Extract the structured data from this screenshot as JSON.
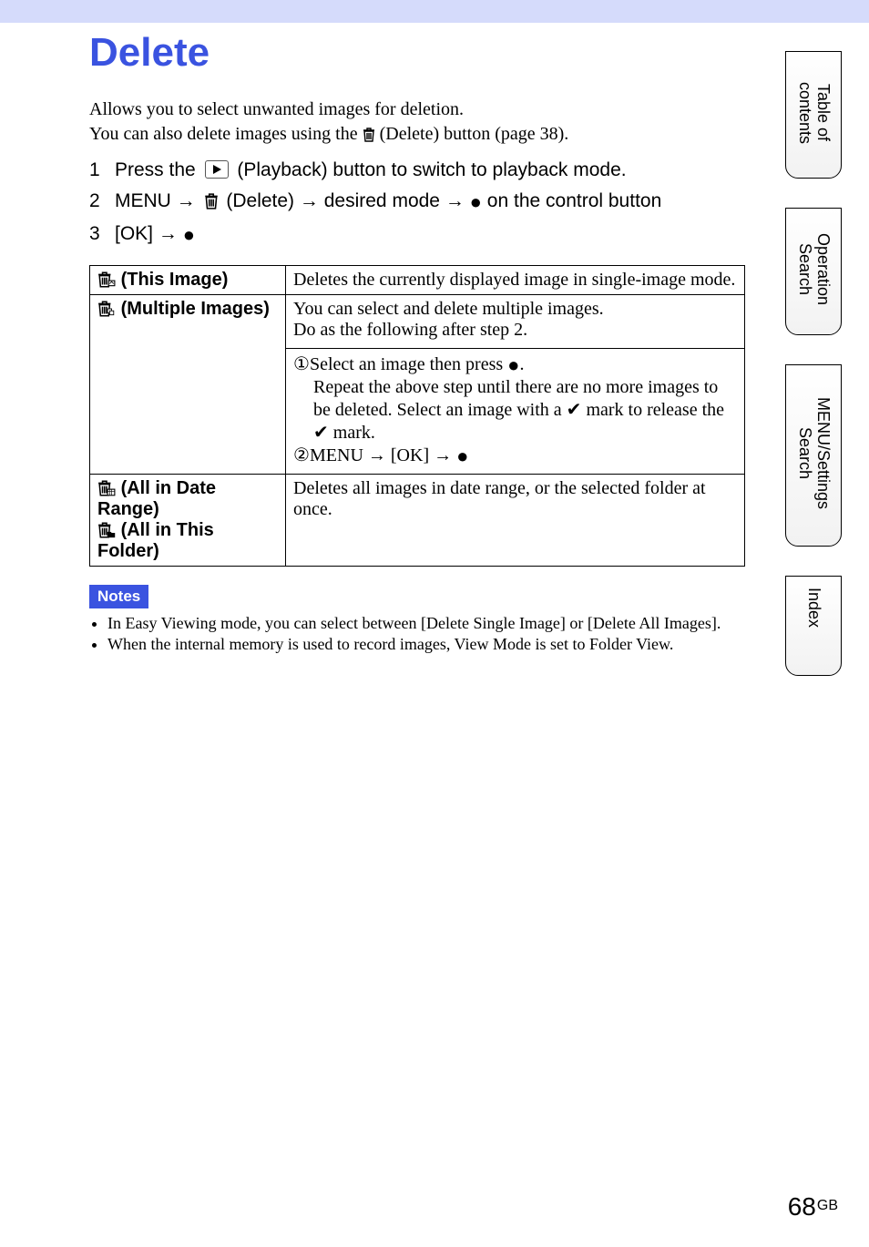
{
  "title": "Delete",
  "intro": {
    "line1": "Allows you to select unwanted images for deletion.",
    "line2a": "You can also delete images using the ",
    "line2b": " (Delete) button (page 38)."
  },
  "steps": {
    "s1": {
      "num": "1",
      "a": "Press the ",
      "b": " (Playback) button to switch to playback mode."
    },
    "s2": {
      "num": "2",
      "a": "MENU ",
      "arrow1": "→",
      "b": " (Delete) ",
      "arrow2": "→",
      "c": " desired mode ",
      "arrow3": "→",
      "d": " on the control button"
    },
    "s3": {
      "num": "3",
      "a": "[OK] ",
      "arrow": "→"
    }
  },
  "rows": {
    "r1": {
      "label": " (This Image)",
      "desc": "Deletes the currently displayed image in single-image mode."
    },
    "r2": {
      "label": " (Multiple Images)",
      "desc_a": "You can select and delete multiple images.",
      "desc_b": "Do as the following after step 2.",
      "step1num": "①",
      "step1a": "Select an image then press ",
      "step1b": ".",
      "step1c": "Repeat the above step until there are no more images to be deleted. Select an image with a ",
      "step1d": " mark to release the ",
      "step1e": " mark.",
      "step2num": "②",
      "step2a": "MENU ",
      "step2arrow1": "→",
      "step2b": " [OK] ",
      "step2arrow2": "→"
    },
    "r3": {
      "label_a": " (All in Date Range)",
      "label_b": " (All in This Folder)",
      "desc": "Deletes all images in date range, or the selected folder at once."
    }
  },
  "notes": {
    "heading": "Notes",
    "n1": "In Easy Viewing mode, you can select between [Delete Single Image] or [Delete All Images].",
    "n2": "When the internal memory is used to record images, View Mode is set to Folder View."
  },
  "sidetabs": {
    "toc": "Table of contents",
    "op": "Operation Search",
    "menu": "MENU/Settings Search",
    "index": "Index"
  },
  "page": {
    "num": "68",
    "region": "GB"
  },
  "icons": {
    "trash": "trash-icon",
    "play": "playback-icon",
    "center": "center-button-icon",
    "arrow": "right-arrow-icon",
    "check": "check-mark-icon"
  }
}
